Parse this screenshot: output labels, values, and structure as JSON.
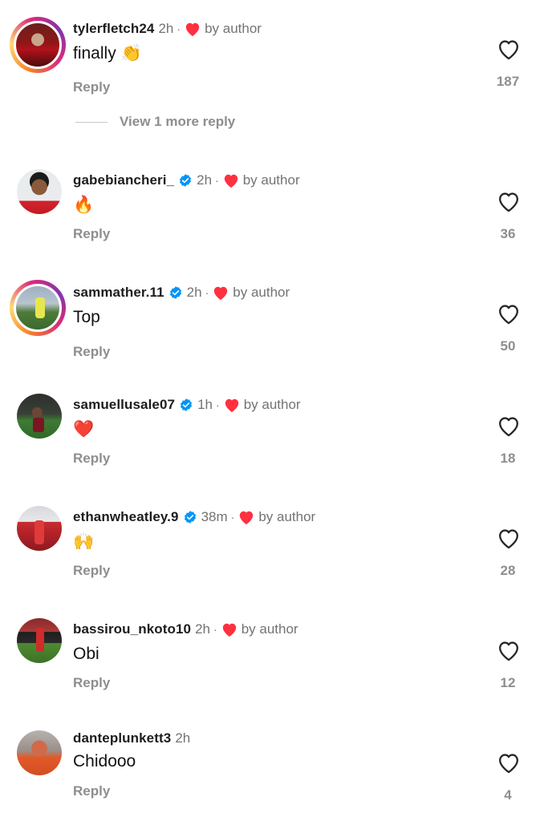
{
  "comments": [
    {
      "username": "tylerfletch24",
      "verified": false,
      "time": "2h",
      "liked_label": "by author",
      "text": "finally",
      "emoji": "👏",
      "reply": "Reply",
      "likes": "187",
      "story_ring": true
    },
    {
      "username": "gabebiancheri_",
      "verified": true,
      "time": "2h",
      "liked_label": "by author",
      "text": "",
      "emoji": "🔥",
      "reply": "Reply",
      "likes": "36",
      "story_ring": false
    },
    {
      "username": "sammather.11",
      "verified": true,
      "time": "2h",
      "liked_label": "by author",
      "text": "Top",
      "emoji": "",
      "reply": "Reply",
      "likes": "50",
      "story_ring": true
    },
    {
      "username": "samuellusale07",
      "verified": true,
      "time": "1h",
      "liked_label": "by author",
      "text": "",
      "emoji": "❤️",
      "reply": "Reply",
      "likes": "18",
      "story_ring": false
    },
    {
      "username": "ethanwheatley.9",
      "verified": true,
      "time": "38m",
      "liked_label": "by author",
      "text": "",
      "emoji": "🙌",
      "reply": "Reply",
      "likes": "28",
      "story_ring": false
    },
    {
      "username": "bassirou_nkoto10",
      "verified": false,
      "time": "2h",
      "liked_label": "by author",
      "text": "Obi",
      "emoji": "",
      "reply": "Reply",
      "likes": "12",
      "story_ring": false
    },
    {
      "username": "danteplunkett3",
      "verified": false,
      "time": "2h",
      "liked_label": "",
      "text": "Chidooo",
      "emoji": "",
      "reply": "Reply",
      "likes": "4",
      "story_ring": false
    }
  ],
  "view_more_replies": "View 1 more reply",
  "icons": {
    "verified": "verified-badge-icon",
    "author_heart": "heart-filled-icon",
    "like": "heart-outline-icon"
  },
  "colors": {
    "verified_blue": "#0095f6",
    "heart_red": "#ff3040",
    "muted_text": "#8e8e8e"
  }
}
